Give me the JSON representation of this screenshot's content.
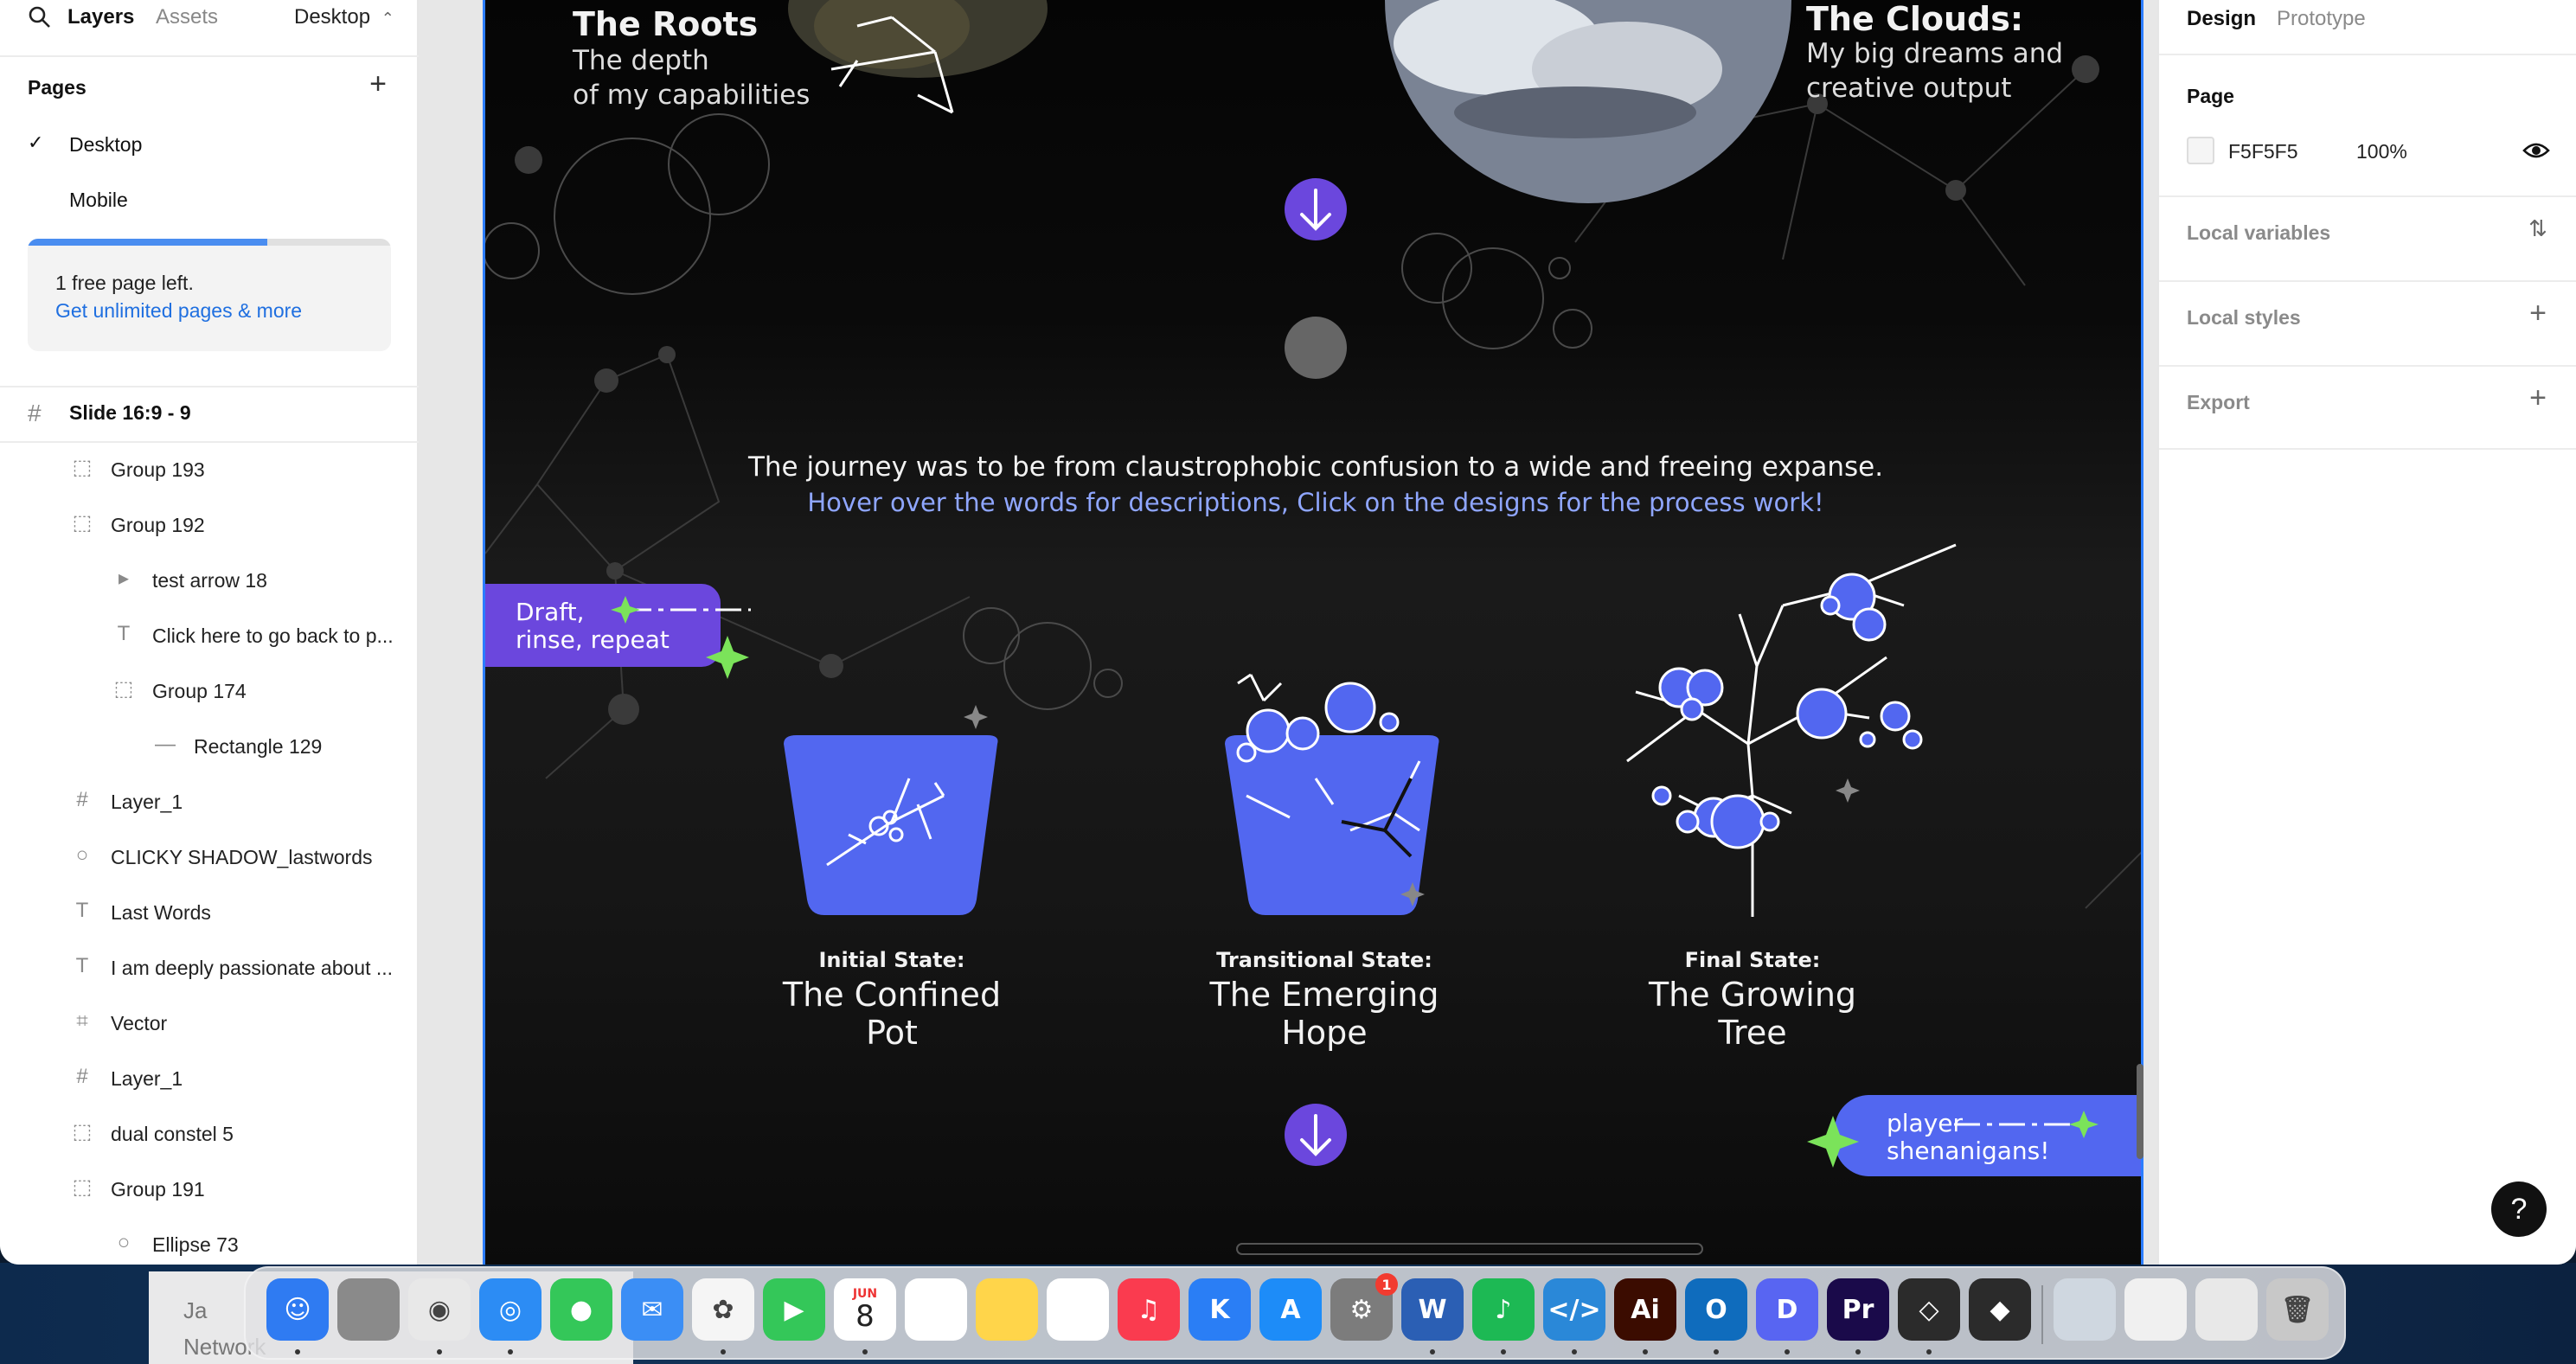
{
  "left_panel": {
    "tabs": {
      "layers": "Layers",
      "assets": "Assets"
    },
    "page_dropdown": "Desktop",
    "pages_header": "Pages",
    "pages": [
      {
        "label": "Desktop",
        "selected": true
      },
      {
        "label": "Mobile",
        "selected": false
      }
    ],
    "upsell": {
      "line1": "1 free page left.",
      "line2": "Get unlimited pages & more",
      "progress_fraction": 0.66
    },
    "frame_name": "Slide 16:9 - 9",
    "layers": [
      {
        "name": "Group 193",
        "icon": "group-icon"
      },
      {
        "name": "Group 192",
        "icon": "group-icon"
      },
      {
        "name": "test arrow 18",
        "icon": "component-icon"
      },
      {
        "name": "Click here to go back to p...",
        "icon": "text-icon"
      },
      {
        "name": "Group 174",
        "icon": "group-icon"
      },
      {
        "name": "Rectangle 129",
        "icon": "line-icon"
      },
      {
        "name": "Layer_1",
        "icon": "frame-icon"
      },
      {
        "name": "CLICKY SHADOW_lastwords",
        "icon": "ellipse-icon"
      },
      {
        "name": "Last Words",
        "icon": "text-icon"
      },
      {
        "name": "I am deeply passionate about ...",
        "icon": "text-icon"
      },
      {
        "name": "Vector",
        "icon": "vector-icon"
      },
      {
        "name": "Layer_1",
        "icon": "frame-icon"
      },
      {
        "name": "dual constel 5",
        "icon": "group-icon"
      },
      {
        "name": "Group 191",
        "icon": "group-icon"
      },
      {
        "name": "Ellipse 73",
        "icon": "ellipse-icon"
      }
    ]
  },
  "canvas": {
    "roots": {
      "title": "The Roots",
      "line1": "The depth",
      "line2": "of my capabilities"
    },
    "clouds": {
      "title": "The Clouds:",
      "line1": "My big dreams and",
      "line2": "creative output"
    },
    "journey_line1": "The journey was to be from claustrophobic confusion to a wide and freeing expanse.",
    "journey_line2": "Hover over the words for descriptions, Click on the designs for the process work!",
    "draft_tag": {
      "line1": "Draft,",
      "line2": "rinse, repeat"
    },
    "player_tag": {
      "line1": "player",
      "line2": "shenanigans!"
    },
    "states": [
      {
        "label": "Initial State:",
        "title1": "The Confined",
        "title2": "Pot"
      },
      {
        "label": "Transitional State:",
        "title1": "The Emerging",
        "title2": "Hope"
      },
      {
        "label": "Final State:",
        "title1": "The Growing",
        "title2": "Tree"
      }
    ],
    "colors": {
      "accent_blue": "#5267f0",
      "accent_purple": "#6b47dd",
      "sparkle_green": "#7be35a",
      "frame_selection": "#2c7dff"
    }
  },
  "right_panel": {
    "tabs": {
      "design": "Design",
      "prototype": "Prototype"
    },
    "page_section": "Page",
    "page_color": "F5F5F5",
    "page_opacity": "100%",
    "sections": [
      "Local variables",
      "Local styles",
      "Export"
    ]
  },
  "finder_behind": {
    "row1": "Ja",
    "row2": "Network"
  },
  "dock": {
    "calendar_month": "JUN",
    "calendar_day": "8",
    "settings_badge": "1",
    "apps": [
      "finder-icon",
      "launchpad-icon",
      "chrome-icon",
      "safari-icon",
      "messages-icon",
      "mail-icon",
      "photos-icon",
      "facetime-icon",
      "calendar-icon",
      "reminders-icon",
      "notes-icon",
      "freeform-icon",
      "music-icon",
      "keynote-icon",
      "app-store-icon",
      "system-settings-icon",
      "word-icon",
      "spotify-icon",
      "vscode-icon",
      "illustrator-icon",
      "outlook-icon",
      "discord-icon",
      "premiere-icon",
      "unity-icon",
      "unity-hub-icon",
      "preview-icon",
      "document-icon",
      "screenshot-icon",
      "trash-icon"
    ]
  }
}
